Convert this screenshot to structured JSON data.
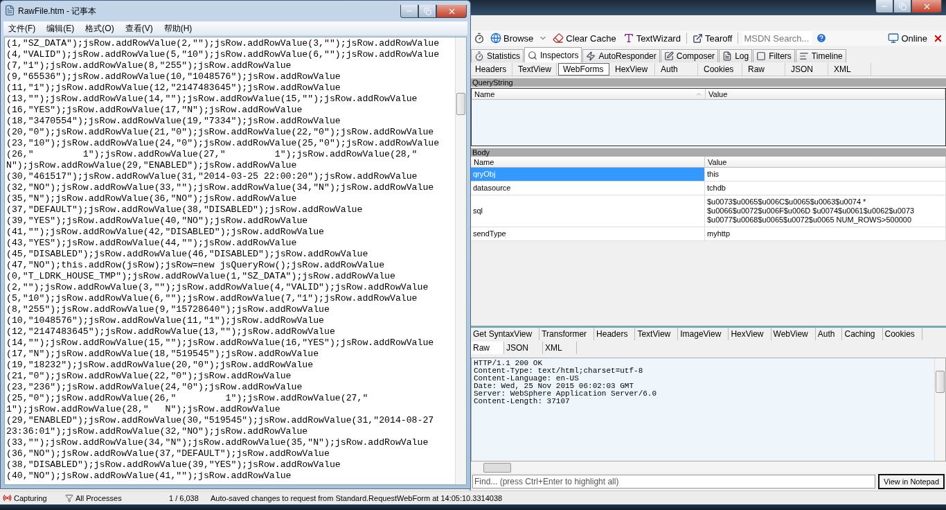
{
  "notepad": {
    "title": "RawFile.htm - 记事本",
    "menu": [
      "文件(F)",
      "编辑(E)",
      "格式(O)",
      "查看(V)",
      "帮助(H)"
    ],
    "lines": [
      "(1,\"SZ_DATA\");jsRow.addRowValue(2,\"\");jsRow.addRowValue(3,\"\");jsRow.addRowValue",
      "(4,\"VALID\");jsRow.addRowValue(5,\"10\");jsRow.addRowValue(6,\"\");jsRow.addRowValue",
      "(7,\"1\");jsRow.addRowValue(8,\"255\");jsRow.addRowValue",
      "(9,\"65536\");jsRow.addRowValue(10,\"1048576\");jsRow.addRowValue",
      "(11,\"1\");jsRow.addRowValue(12,\"2147483645\");jsRow.addRowValue",
      "(13,\"\");jsRow.addRowValue(14,\"\");jsRow.addRowValue(15,\"\");jsRow.addRowValue",
      "(16,\"YES\");jsRow.addRowValue(17,\"N\");jsRow.addRowValue",
      "(18,\"3470554\");jsRow.addRowValue(19,\"7334\");jsRow.addRowValue",
      "(20,\"0\");jsRow.addRowValue(21,\"0\");jsRow.addRowValue(22,\"0\");jsRow.addRowValue",
      "(23,\"10\");jsRow.addRowValue(24,\"0\");jsRow.addRowValue(25,\"0\");jsRow.addRowValue",
      "(26,\"         1\");jsRow.addRowValue(27,\"         1\");jsRow.addRowValue(28,\"",
      "N\");jsRow.addRowValue(29,\"ENABLED\");jsRow.addRowValue",
      "(30,\"461517\");jsRow.addRowValue(31,\"2014-03-25 22:00:20\");jsRow.addRowValue",
      "(32,\"NO\");jsRow.addRowValue(33,\"\");jsRow.addRowValue(34,\"N\");jsRow.addRowValue",
      "(35,\"N\");jsRow.addRowValue(36,\"NO\");jsRow.addRowValue",
      "(37,\"DEFAULT\");jsRow.addRowValue(38,\"DISABLED\");jsRow.addRowValue",
      "(39,\"YES\");jsRow.addRowValue(40,\"NO\");jsRow.addRowValue",
      "(41,\"\");jsRow.addRowValue(42,\"DISABLED\");jsRow.addRowValue",
      "(43,\"YES\");jsRow.addRowValue(44,\"\");jsRow.addRowValue",
      "(45,\"DISABLED\");jsRow.addRowValue(46,\"DISABLED\");jsRow.addRowValue",
      "(47,\"NO\");this.addRow(jsRow);jsRow=new jsQueryRow();jsRow.addRowValue",
      "(0,\"T_LDRK_HOUSE_TMP\");jsRow.addRowValue(1,\"SZ_DATA\");jsRow.addRowValue",
      "(2,\"\");jsRow.addRowValue(3,\"\");jsRow.addRowValue(4,\"VALID\");jsRow.addRowValue",
      "(5,\"10\");jsRow.addRowValue(6,\"\");jsRow.addRowValue(7,\"1\");jsRow.addRowValue",
      "(8,\"255\");jsRow.addRowValue(9,\"15728640\");jsRow.addRowValue",
      "(10,\"1048576\");jsRow.addRowValue(11,\"1\");jsRow.addRowValue",
      "(12,\"2147483645\");jsRow.addRowValue(13,\"\");jsRow.addRowValue",
      "(14,\"\");jsRow.addRowValue(15,\"\");jsRow.addRowValue(16,\"YES\");jsRow.addRowValue",
      "(17,\"N\");jsRow.addRowValue(18,\"519545\");jsRow.addRowValue",
      "(19,\"18232\");jsRow.addRowValue(20,\"0\");jsRow.addRowValue",
      "(21,\"0\");jsRow.addRowValue(22,\"0\");jsRow.addRowValue",
      "(23,\"236\");jsRow.addRowValue(24,\"0\");jsRow.addRowValue",
      "(25,\"0\");jsRow.addRowValue(26,\"         1\");jsRow.addRowValue(27,\"",
      "1\");jsRow.addRowValue(28,\"   N\");jsRow.addRowValue",
      "(29,\"ENABLED\");jsRow.addRowValue(30,\"519545\");jsRow.addRowValue(31,\"2014-08-27",
      "23:36:01\");jsRow.addRowValue(32,\"NO\");jsRow.addRowValue",
      "(33,\"\");jsRow.addRowValue(34,\"N\");jsRow.addRowValue(35,\"N\");jsRow.addRowValue",
      "(36,\"NO\");jsRow.addRowValue(37,\"DEFAULT\");jsRow.addRowValue",
      "(38,\"DISABLED\");jsRow.addRowValue(39,\"YES\");jsRow.addRowValue",
      "(40,\"NO\");jsRow.addRowValue(41,\"\");jsRow.addRowValue"
    ]
  },
  "fiddler": {
    "toolbar": {
      "browse": "Browse",
      "clear_cache": "Clear Cache",
      "text_wizard": "TextWizard",
      "tearoff": "Tearoff",
      "search_placeholder": "MSDN Search...",
      "online": "Online"
    },
    "tabs": [
      {
        "label": "Statistics",
        "selected": false
      },
      {
        "label": "Inspectors",
        "selected": true
      },
      {
        "label": "AutoResponder",
        "selected": false
      },
      {
        "label": "Composer",
        "selected": false
      },
      {
        "label": "Log",
        "selected": false
      },
      {
        "label": "Filters",
        "selected": false
      },
      {
        "label": "Timeline",
        "selected": false
      }
    ],
    "request_tabs": [
      {
        "label": "Headers",
        "selected": false
      },
      {
        "label": "TextView",
        "selected": false
      },
      {
        "label": "WebForms",
        "selected": true
      },
      {
        "label": "HexView",
        "selected": false
      },
      {
        "label": "Auth",
        "selected": false
      },
      {
        "label": "Cookies",
        "selected": false
      },
      {
        "label": "Raw",
        "selected": false
      },
      {
        "label": "JSON",
        "selected": false
      },
      {
        "label": "XML",
        "selected": false
      }
    ],
    "query_string": {
      "title": "QueryString",
      "columns": [
        "Name",
        "Value"
      ]
    },
    "body": {
      "title": "Body",
      "columns": [
        "Name",
        "Value"
      ],
      "rows": [
        {
          "name": "qryObj",
          "value": "this",
          "selected": true
        },
        {
          "name": "datasource",
          "value": "tchdb",
          "selected": false
        },
        {
          "name": "sql",
          "value": "$u0073$u0065$u006C$u0065$u0063$u0074 * $u0066$u0072$u006F$u006D $u0074$u0061$u0062$u0073 $u0077$u0068$u0065$u0072$u0065 NUM_ROWS>500000",
          "selected": false
        },
        {
          "name": "sendType",
          "value": "myhttp",
          "selected": false
        }
      ]
    },
    "response_tabs": [
      {
        "label": "Get SyntaxView",
        "selected": false
      },
      {
        "label": "Transformer",
        "selected": false
      },
      {
        "label": "Headers",
        "selected": false
      },
      {
        "label": "TextView",
        "selected": false
      },
      {
        "label": "ImageView",
        "selected": false
      },
      {
        "label": "HexView",
        "selected": false
      },
      {
        "label": "WebView",
        "selected": false
      },
      {
        "label": "Auth",
        "selected": false
      },
      {
        "label": "Caching",
        "selected": false
      },
      {
        "label": "Cookies",
        "selected": false
      }
    ],
    "response_view_tabs": [
      {
        "label": "Raw",
        "selected": true
      },
      {
        "label": "JSON",
        "selected": false
      },
      {
        "label": "XML",
        "selected": false
      }
    ],
    "response_lines": [
      "HTTP/1.1 200 OK",
      "Content-Type: text/html;charset=utf-8",
      "Content-Language: en-US",
      "Date: Wed, 25 Nov 2015 06:02:03 GMT",
      "Server: WebSphere Application Server/6.0",
      "Content-Length: 37107"
    ],
    "find_placeholder": "Find... (press Ctrl+Enter to highlight all)",
    "view_button": "View in Notepad",
    "status_bar": {
      "capturing": "Capturing",
      "processes": "All Processes",
      "count": "1 / 6,038",
      "message": "Auto-saved changes to request from Standard.RequestWebForm at 14:05:10.3314038"
    }
  }
}
